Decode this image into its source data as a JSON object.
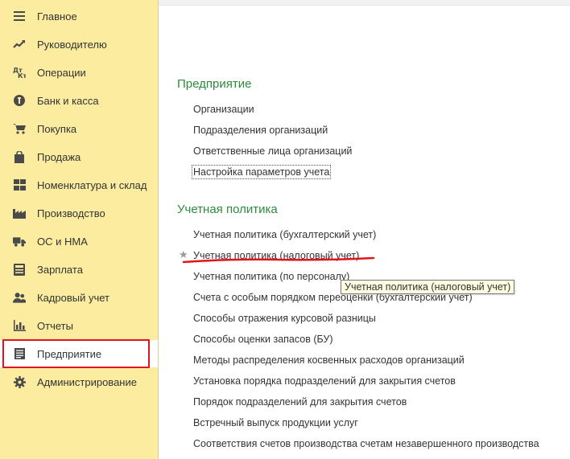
{
  "sidebar": {
    "items": [
      {
        "label": "Главное",
        "icon": "menu-icon"
      },
      {
        "label": "Руководителю",
        "icon": "trend-icon"
      },
      {
        "label": "Операции",
        "icon": "debit-credit-icon"
      },
      {
        "label": "Банк и касса",
        "icon": "coin-icon"
      },
      {
        "label": "Покупка",
        "icon": "cart-icon"
      },
      {
        "label": "Продажа",
        "icon": "bag-icon"
      },
      {
        "label": "Номенклатура и склад",
        "icon": "grid-icon"
      },
      {
        "label": "Производство",
        "icon": "factory-icon"
      },
      {
        "label": "ОС и НМА",
        "icon": "truck-icon"
      },
      {
        "label": "Зарплата",
        "icon": "calculator-icon"
      },
      {
        "label": "Кадровый учет",
        "icon": "people-icon"
      },
      {
        "label": "Отчеты",
        "icon": "bar-chart-icon"
      },
      {
        "label": "Предприятие",
        "icon": "document-icon"
      },
      {
        "label": "Администрирование",
        "icon": "gear-icon"
      }
    ],
    "active": "Предприятие"
  },
  "main": {
    "sections": [
      {
        "title": "Предприятие",
        "links": [
          "Организации",
          "Подразделения организаций",
          "Ответственные лица организаций",
          "Настройка параметров учета"
        ]
      },
      {
        "title": "Учетная политика",
        "links": [
          "Учетная политика (бухгалтерский учет)",
          "Учетная политика (налоговый учет)",
          "Учетная политика (по персоналу)",
          "Счета с особым порядком переоценки (бухгалтерский учет)",
          "Способы отражения курсовой разницы",
          "Способы оценки запасов (БУ)",
          "Методы распределения косвенных расходов организаций",
          "Установка порядка подразделений для закрытия счетов",
          "Порядок подразделений для закрытия счетов",
          "Встречный выпуск продукции услуг",
          "Соответствия счетов производства счетам незавершенного производства"
        ]
      }
    ]
  },
  "tooltip": {
    "text": "Учетная политика (налоговый учет)"
  },
  "colors": {
    "sidebar_bg": "#fbeca0",
    "section_title": "#2e8b3d",
    "highlight_red": "#e2131a",
    "tooltip_bg": "#fffde1"
  }
}
